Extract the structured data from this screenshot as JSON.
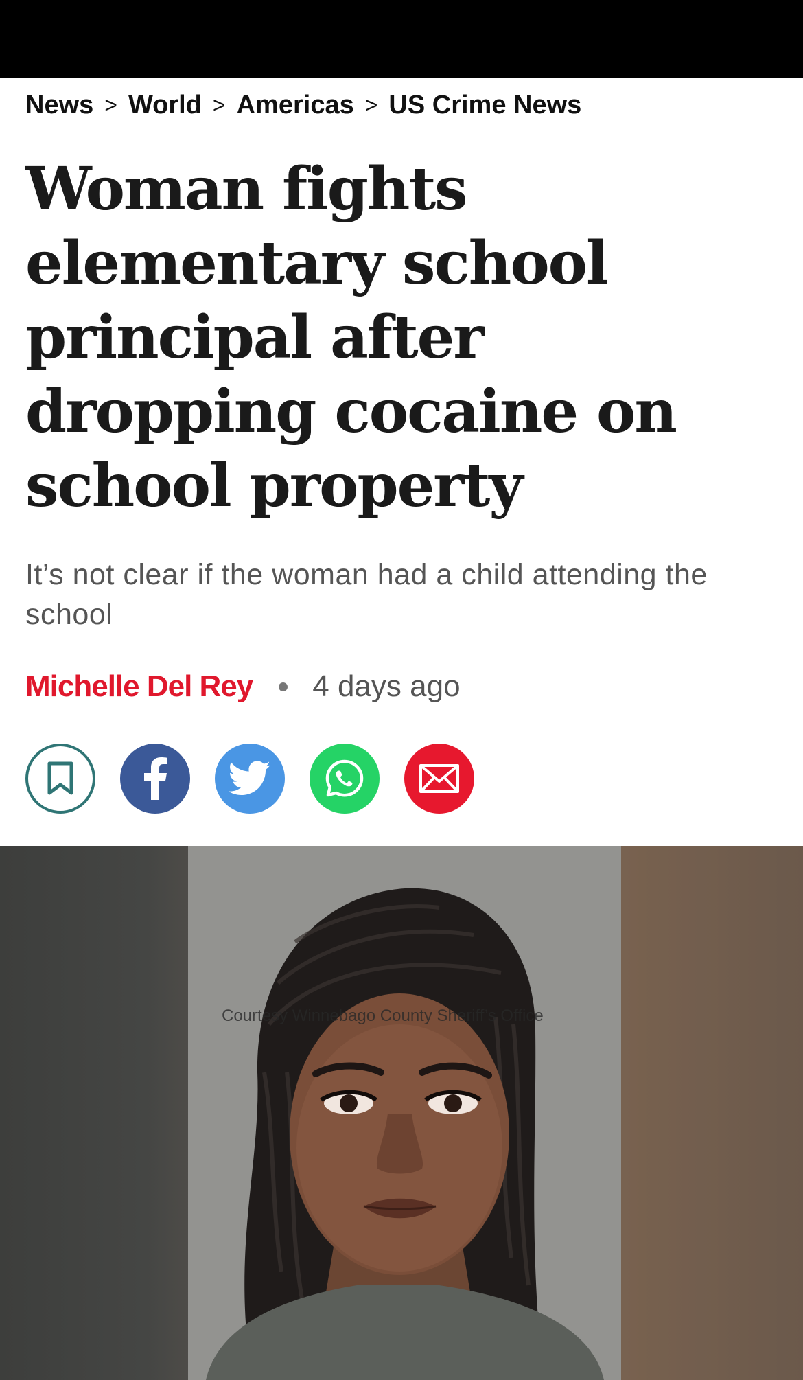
{
  "breadcrumb": {
    "items": [
      "News",
      "World",
      "Americas",
      "US Crime News"
    ],
    "separator": ">"
  },
  "article": {
    "headline": "Woman fights elementary school principal after dropping cocaine on school property",
    "standfirst": "It’s not clear if the woman had a child attending the school",
    "author": "Michelle Del Rey",
    "published": "4 days ago"
  },
  "share": {
    "buttons": [
      {
        "name": "bookmark",
        "icon": "bookmark-icon",
        "color": "#2f7575"
      },
      {
        "name": "facebook",
        "icon": "facebook-icon",
        "color": "#3b5998"
      },
      {
        "name": "twitter",
        "icon": "twitter-icon",
        "color": "#4a96e4"
      },
      {
        "name": "whatsapp",
        "icon": "whatsapp-icon",
        "color": "#25d366"
      },
      {
        "name": "email",
        "icon": "email-icon",
        "color": "#e7182e"
      }
    ]
  },
  "image": {
    "credit": "Courtesy Winnebago County Sheriff’s Office"
  },
  "colors": {
    "accent": "#e0182d",
    "topbar": "#000000"
  }
}
